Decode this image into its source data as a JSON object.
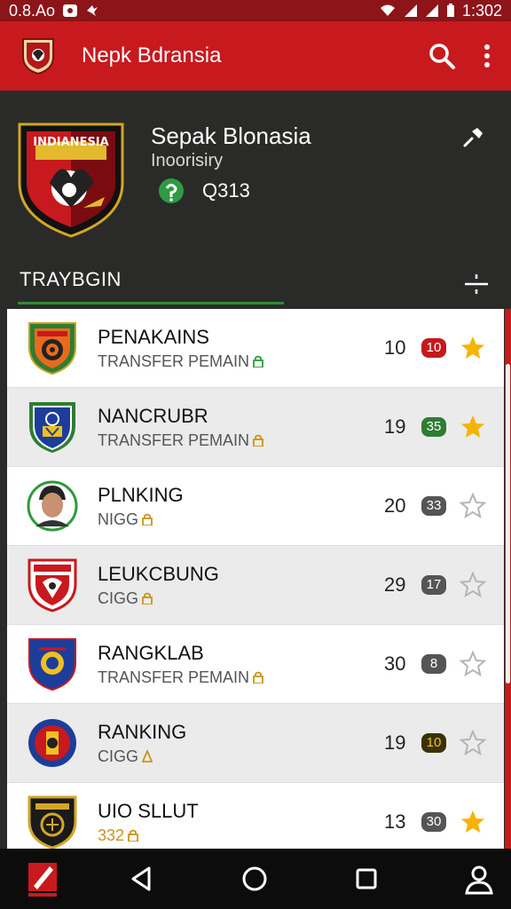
{
  "status": {
    "time_left": "0.8.Ao",
    "clock": "1:302"
  },
  "toolbar": {
    "title": "Nepk Bdransia"
  },
  "team": {
    "name": "Sepak Blonasia",
    "sub": "Inoorisiry",
    "code": "Q313",
    "crest_text": "INDIANESIA"
  },
  "tab": {
    "label": "TRAYBGIN"
  },
  "rows": [
    {
      "name": "PENAKAINS",
      "sub": "TRANSFER PEMAIN",
      "num": "10",
      "badge": "10",
      "badge_color": "#c41a1e",
      "star": "gold"
    },
    {
      "name": "NANCRUBR",
      "sub": "TRANSFER PEMAIN",
      "num": "19",
      "badge": "35",
      "badge_color": "#2e7d32",
      "star": "gold"
    },
    {
      "name": "PLNKING",
      "sub": "NIGG",
      "num": "20",
      "badge": "33",
      "badge_color": "#555555",
      "star": "grey"
    },
    {
      "name": "LEUKCBUNG",
      "sub": "CIGG",
      "num": "29",
      "badge": "17",
      "badge_color": "#555555",
      "star": "grey"
    },
    {
      "name": "RANGKLAB",
      "sub": "TRANSFER PEMAIN",
      "num": "30",
      "badge": "8",
      "badge_color": "#555555",
      "star": "grey"
    },
    {
      "name": "RANKING",
      "sub": "CIGG",
      "num": "19",
      "badge": "10",
      "badge_color": "#3b3108",
      "star": "grey"
    },
    {
      "name": "UIO SLLUT",
      "sub": "332",
      "num": "13",
      "badge": "30",
      "badge_color": "#555555",
      "star": "gold"
    }
  ]
}
